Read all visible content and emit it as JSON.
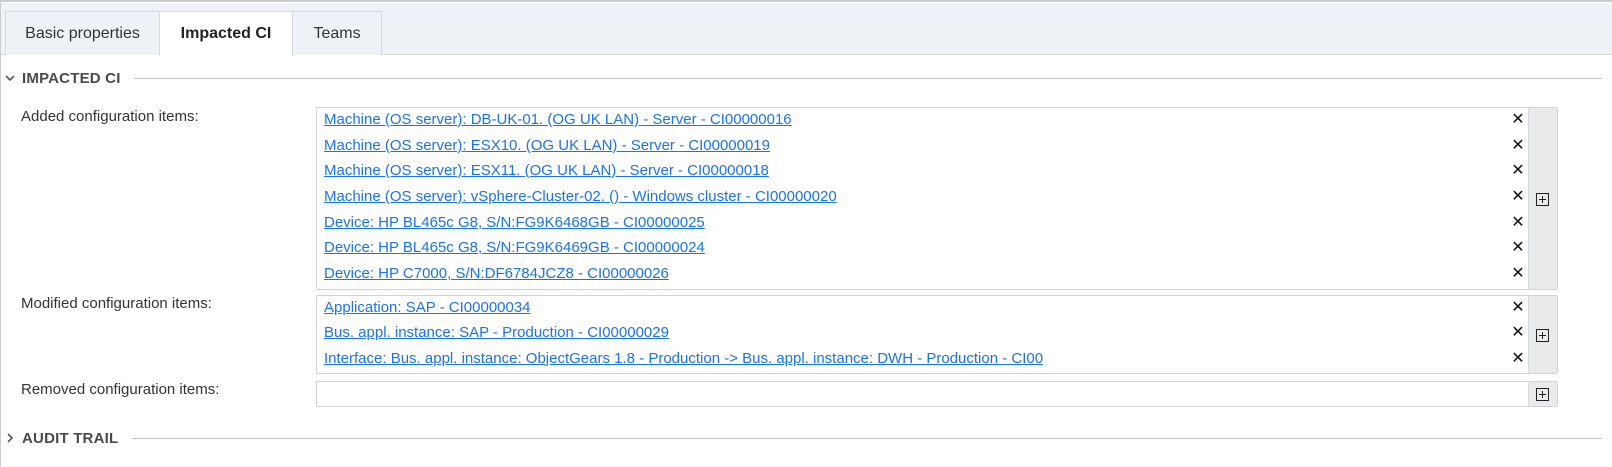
{
  "tabs": [
    {
      "label": "Basic properties",
      "active": false
    },
    {
      "label": "Impacted CI",
      "active": true
    },
    {
      "label": "Teams",
      "active": false
    }
  ],
  "sections": {
    "impacted": {
      "title": "IMPACTED CI",
      "expanded": true,
      "icon": "chevron-down-icon"
    },
    "audit": {
      "title": "AUDIT TRAIL",
      "expanded": false,
      "icon": "chevron-right-icon"
    }
  },
  "fields": {
    "added": {
      "label": "Added configuration items:",
      "items": [
        "Machine (OS server): DB-UK-01. (OG UK LAN) - Server - CI00000016",
        "Machine (OS server): ESX10. (OG UK LAN) - Server - CI00000019",
        "Machine (OS server): ESX11. (OG UK LAN) - Server - CI00000018",
        "Machine (OS server): vSphere-Cluster-02. () - Windows cluster - CI00000020",
        "Device: HP BL465c G8, S/N:FG9K6468GB - CI00000025",
        "Device: HP BL465c G8, S/N:FG9K6469GB - CI00000024",
        "Device: HP C7000, S/N:DF6784JCZ8 - CI00000026"
      ]
    },
    "modified": {
      "label": "Modified configuration items:",
      "items": [
        "Application: SAP - CI00000034",
        "Bus. appl. instance: SAP - Production - CI00000029",
        "Interface: Bus. appl. instance: ObjectGears 1.8 - Production -> Bus. appl. instance: DWH - Production - CI00"
      ]
    },
    "removed": {
      "label": "Removed configuration items:",
      "items": []
    }
  },
  "icons": {
    "remove": "close-icon",
    "add": "add-box-icon",
    "remove_glyph": "✕"
  },
  "colors": {
    "link": "#1a73e8",
    "tab_bar": "#eef2f7",
    "add_column": "#e9eaec"
  }
}
